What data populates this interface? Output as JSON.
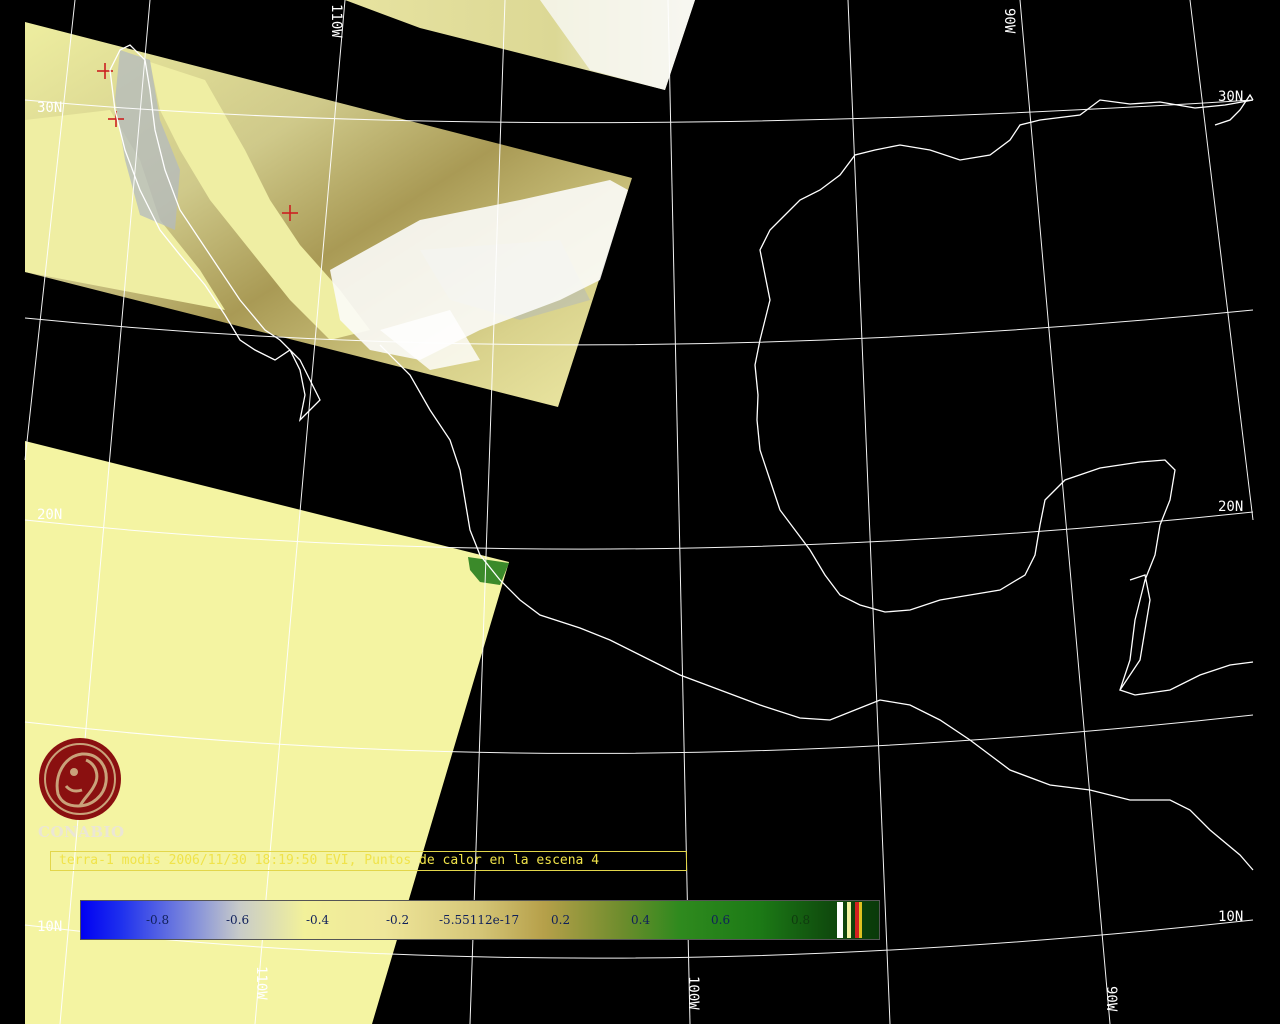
{
  "map": {
    "graticule_labels": {
      "lat_30n_left": "30N",
      "lat_20n_left": "20N",
      "lat_10n_left": "10N",
      "lat_30n_right": "30N",
      "lat_20n_right": "20N",
      "lat_10n_right": "10N",
      "lon_110w_top": "110W",
      "lon_90w_top": "90W",
      "lon_110w_bottom": "110W",
      "lon_100w_bottom": "100W",
      "lon_90w_bottom": "90W"
    },
    "colors": {
      "background": "#000000",
      "coastline": "#ffffff",
      "graticule": "#ffffff",
      "no_data_yellow": "#f4f4a2",
      "cloud": "#ffffff",
      "hotspot_marker": "#cc2020",
      "logo": "#8a1010"
    }
  },
  "logo": {
    "text": "CONABIO"
  },
  "caption": {
    "text": "terra-1 modis 2006/11/30 18:19:50 EVI, Puntos de calor en la escena 4"
  },
  "legend": {
    "labels": [
      "-0.8",
      "-0.6",
      "-0.4",
      "-0.2",
      "-5.55112e-17",
      "0.2",
      "0.4",
      "0.6",
      "0.8"
    ],
    "value_range": [
      -1,
      1
    ]
  }
}
